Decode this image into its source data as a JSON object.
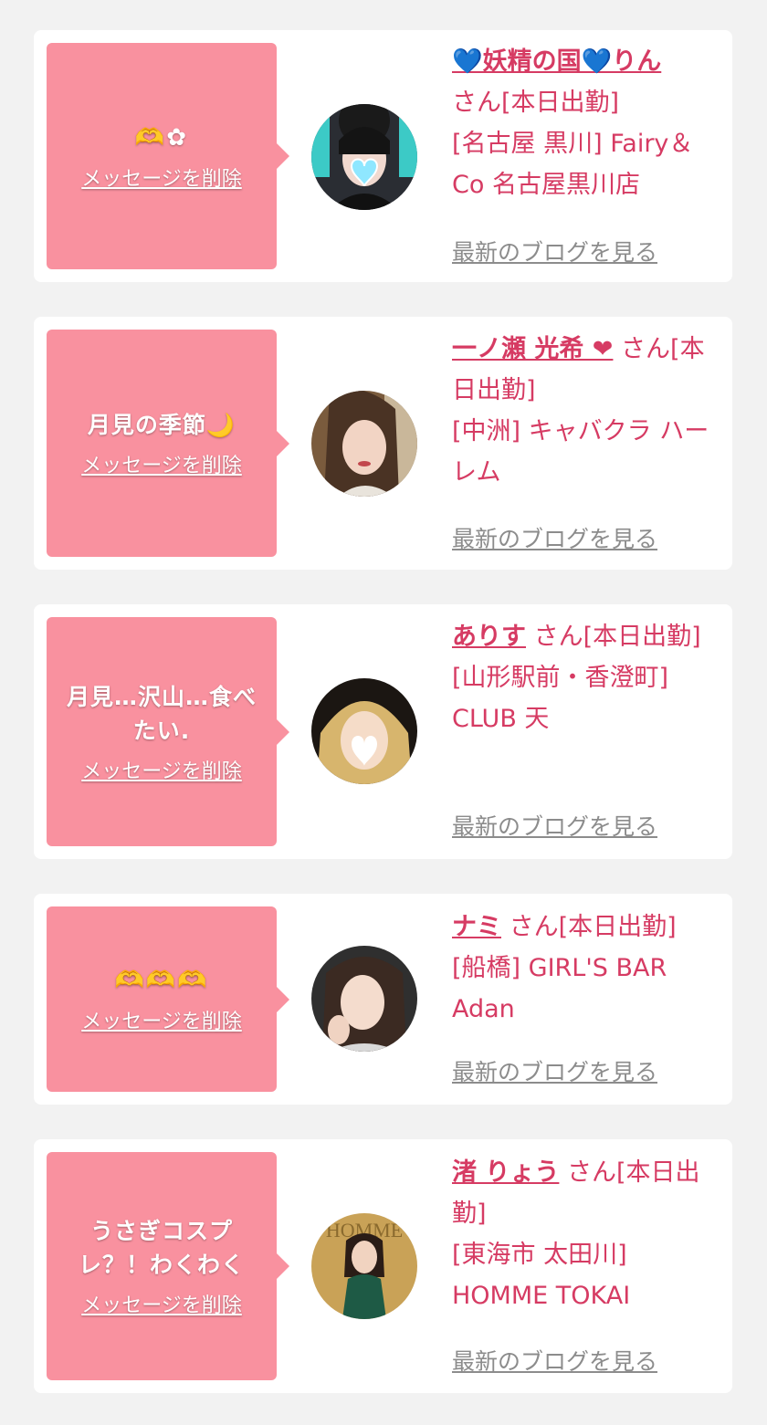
{
  "entries": [
    {
      "message": "🫶✿",
      "delete_label": "メッセージを削除",
      "name": "💙妖精の国💙りん",
      "suffix": "さん[本日出勤]",
      "store": "[名古屋 黒川] Fairy＆Co 名古屋黒川店",
      "blog_label": "最新のブログを見る"
    },
    {
      "message": "月見の季節🌙",
      "delete_label": "メッセージを削除",
      "name": "一ノ瀬 光希 ❤",
      "suffix": "さん[本日出勤]",
      "store": "[中洲] キャバクラ ハーレム",
      "blog_label": "最新のブログを見る"
    },
    {
      "message": "月見…沢山…食べたい.",
      "delete_label": "メッセージを削除",
      "name": "ありす",
      "suffix": "さん[本日出勤]",
      "store": "[山形駅前・香澄町] CLUB 天",
      "blog_label": "最新のブログを見る"
    },
    {
      "message": "🫶🫶🫶",
      "delete_label": "メッセージを削除",
      "name": "ナミ",
      "suffix": "さん[本日出勤]",
      "store": "[船橋] GIRL'S BAR Adan",
      "blog_label": "最新のブログを見る"
    },
    {
      "message": "うさぎコスプレ？！わくわく",
      "delete_label": "メッセージを削除",
      "name": "渚 りょう",
      "suffix": "さん[本日出勤]",
      "store": "[東海市 太田川] HOMME TOKAI",
      "blog_label": "最新のブログを見る"
    }
  ],
  "colors": {
    "background": "#f2f2f2",
    "card": "#ffffff",
    "bubble": "#f9919f",
    "accent": "#d63b63",
    "link_gray": "#8c8c8c"
  }
}
